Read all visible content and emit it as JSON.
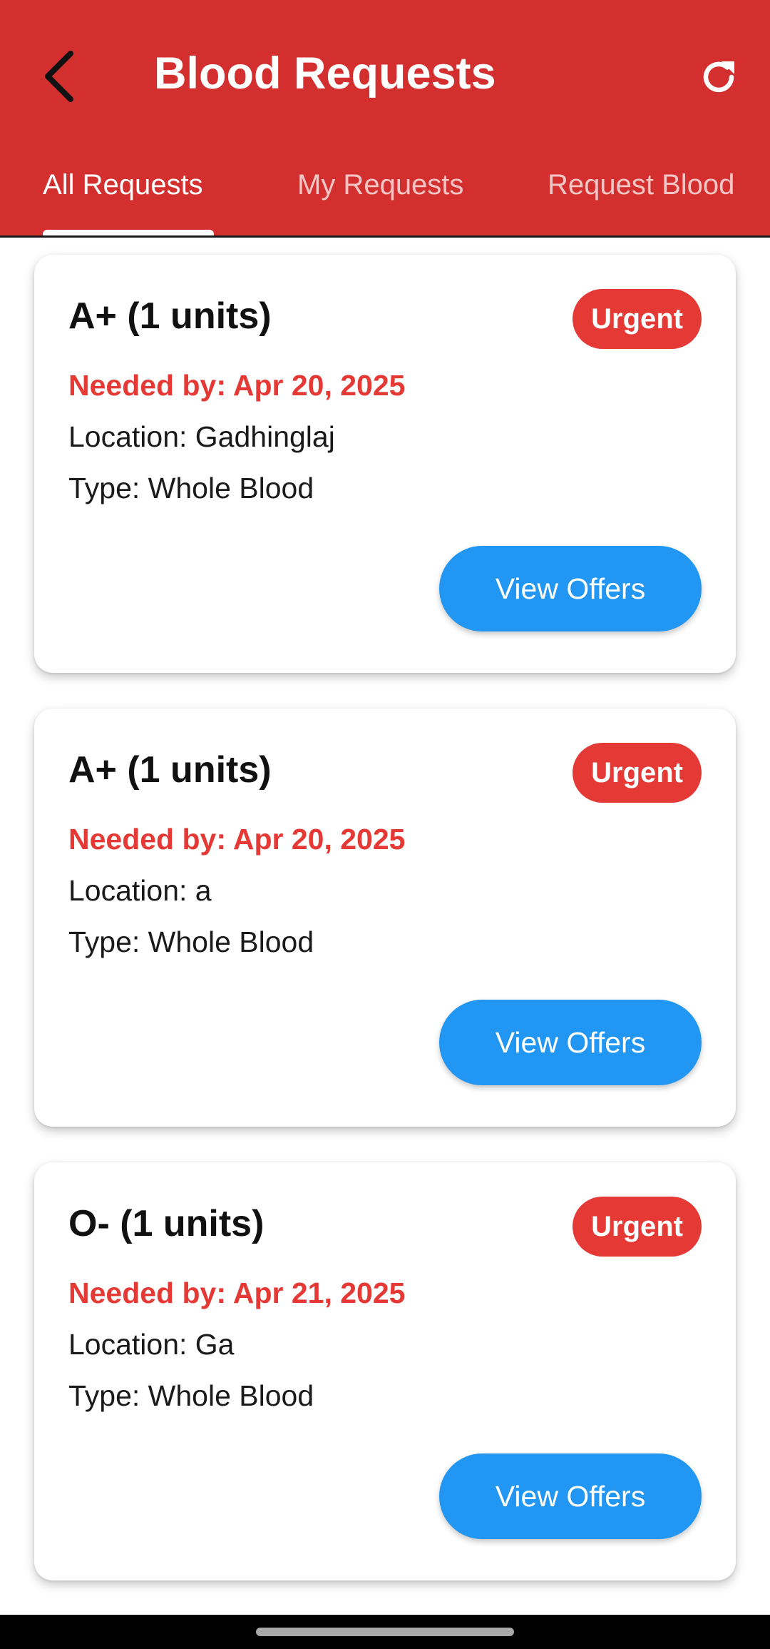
{
  "app_bar": {
    "title": "Blood Requests",
    "back_icon": "arrow-back-icon",
    "refresh_icon": "refresh-icon",
    "color": "#d32f2f"
  },
  "tabs": [
    {
      "label": "All Requests",
      "active": true
    },
    {
      "label": "My Requests",
      "active": false
    },
    {
      "label": "Request Blood",
      "active": false
    }
  ],
  "requests": [
    {
      "title": "A+ (1 units)",
      "badge": "Urgent",
      "needed_by": "Needed by: Apr 20, 2025",
      "location": "Location: Gadhinglaj",
      "type": "Type: Whole Blood",
      "button": "View Offers"
    },
    {
      "title": "A+ (1 units)",
      "badge": "Urgent",
      "needed_by": "Needed by: Apr 20, 2025",
      "location": "Location: a",
      "type": "Type: Whole Blood",
      "button": "View Offers"
    },
    {
      "title": "O- (1 units)",
      "badge": "Urgent",
      "needed_by": "Needed by: Apr 21, 2025",
      "location": "Location: Ga",
      "type": "Type: Whole Blood",
      "button": "View Offers"
    }
  ],
  "colors": {
    "urgent_badge": "#e53935",
    "needed_by_text": "#e53935",
    "view_offers_button": "#2196f3"
  }
}
